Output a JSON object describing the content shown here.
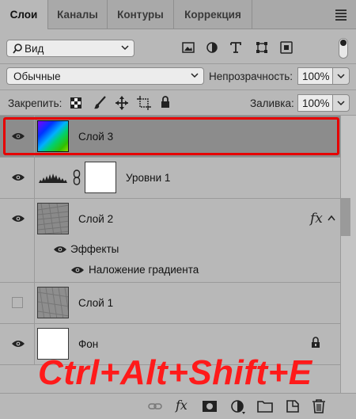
{
  "tabs": [
    {
      "label": "Слои",
      "active": true
    },
    {
      "label": "Каналы",
      "active": false
    },
    {
      "label": "Контуры",
      "active": false
    },
    {
      "label": "Коррекция",
      "active": false
    }
  ],
  "filter": {
    "kind_label": "Вид"
  },
  "blend": {
    "mode": "Обычные",
    "opacity_label": "Непрозрачность:",
    "opacity_value": "100%"
  },
  "lock": {
    "label": "Закрепить:",
    "fill_label": "Заливка:",
    "fill_value": "100%"
  },
  "layers": {
    "layer3": {
      "name": "Слой 3",
      "selected_border_color": "#e60000"
    },
    "levels": {
      "name": "Уровни 1"
    },
    "layer2": {
      "name": "Слой 2",
      "fx": "fx",
      "effects_label": "Эффекты",
      "gradient_overlay_label": "Наложение градиента"
    },
    "layer1": {
      "name": "Слой 1"
    },
    "background": {
      "name": "Фон"
    }
  },
  "bottom": {
    "fx": "fx"
  },
  "overlay_text": "Ctrl+Alt+Shift+E",
  "colors": {
    "selected_row": "#8c8c8c",
    "overlay": "#ff1a1a"
  }
}
